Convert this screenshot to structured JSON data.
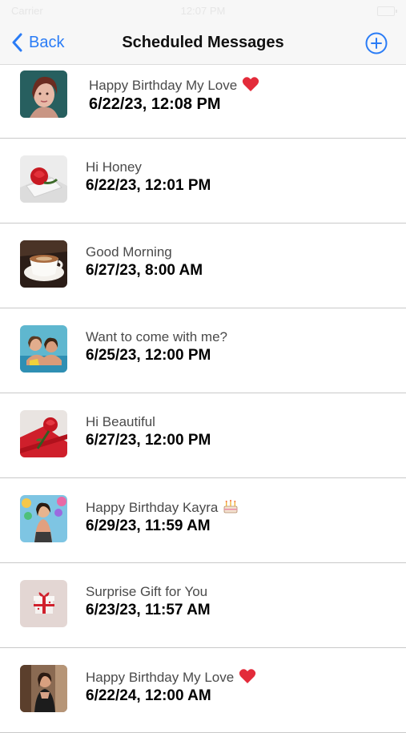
{
  "status_bar": {
    "carrier": "Carrier",
    "time": "12:07 PM"
  },
  "nav": {
    "back_label": "Back",
    "title": "Scheduled Messages",
    "add_icon": "plus-circle-icon"
  },
  "colors": {
    "accent": "#2a7cf6",
    "heart": "#e32b3a"
  },
  "messages": [
    {
      "title": "Happy Birthday My Love",
      "date": "6/22/23, 12:08 PM",
      "emoji": "heart"
    },
    {
      "title": "Hi Honey",
      "date": "6/22/23, 12:01 PM",
      "emoji": ""
    },
    {
      "title": "Good Morning",
      "date": "6/27/23, 8:00 AM",
      "emoji": ""
    },
    {
      "title": "Want to come with me?",
      "date": "6/25/23, 12:00 PM",
      "emoji": ""
    },
    {
      "title": "Hi Beautiful",
      "date": "6/27/23, 12:00 PM",
      "emoji": ""
    },
    {
      "title": "Happy Birthday Kayra",
      "date": "6/29/23, 11:59 AM",
      "emoji": "cake"
    },
    {
      "title": "Surprise Gift for You",
      "date": "6/23/23, 11:57 AM",
      "emoji": ""
    },
    {
      "title": "Happy Birthday My Love",
      "date": "6/22/24, 12:00 AM",
      "emoji": "heart"
    }
  ]
}
